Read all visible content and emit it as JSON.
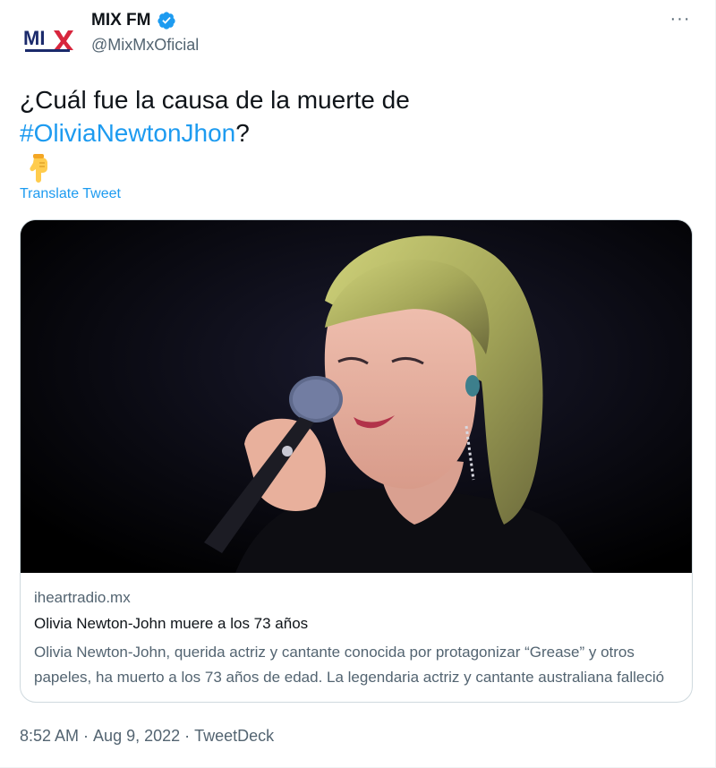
{
  "author": {
    "name": "MIX FM",
    "handle": "@MixMxOficial",
    "avatar_icon": "mix-fm-logo",
    "verified_icon": "verified-badge-icon"
  },
  "tweet": {
    "text_line1": "¿Cuál fue la causa de la muerte de",
    "hashtag": "#OliviaNewtonJhon",
    "after_hashtag": "?",
    "emoji_icon": "pointing-down-hand-icon",
    "translate_label": "Translate Tweet"
  },
  "card": {
    "image_description_icon": "singer-photo",
    "domain": "iheartradio.mx",
    "title": "Olivia Newton-John muere a los 73 años",
    "description": "Olivia Newton-John, querida actriz y cantante conocida por protagonizar “Grease” y otros papeles, ha muerto a los 73 años de edad. La legendaria actriz y cantante australiana falleció"
  },
  "meta": {
    "time": "8:52 AM",
    "date": "Aug 9, 2022",
    "source": "TweetDeck"
  },
  "colors": {
    "accent": "#1d9bf0",
    "secondary_text": "#536471",
    "primary_text": "#0f1419",
    "border": "#cfd9de"
  }
}
